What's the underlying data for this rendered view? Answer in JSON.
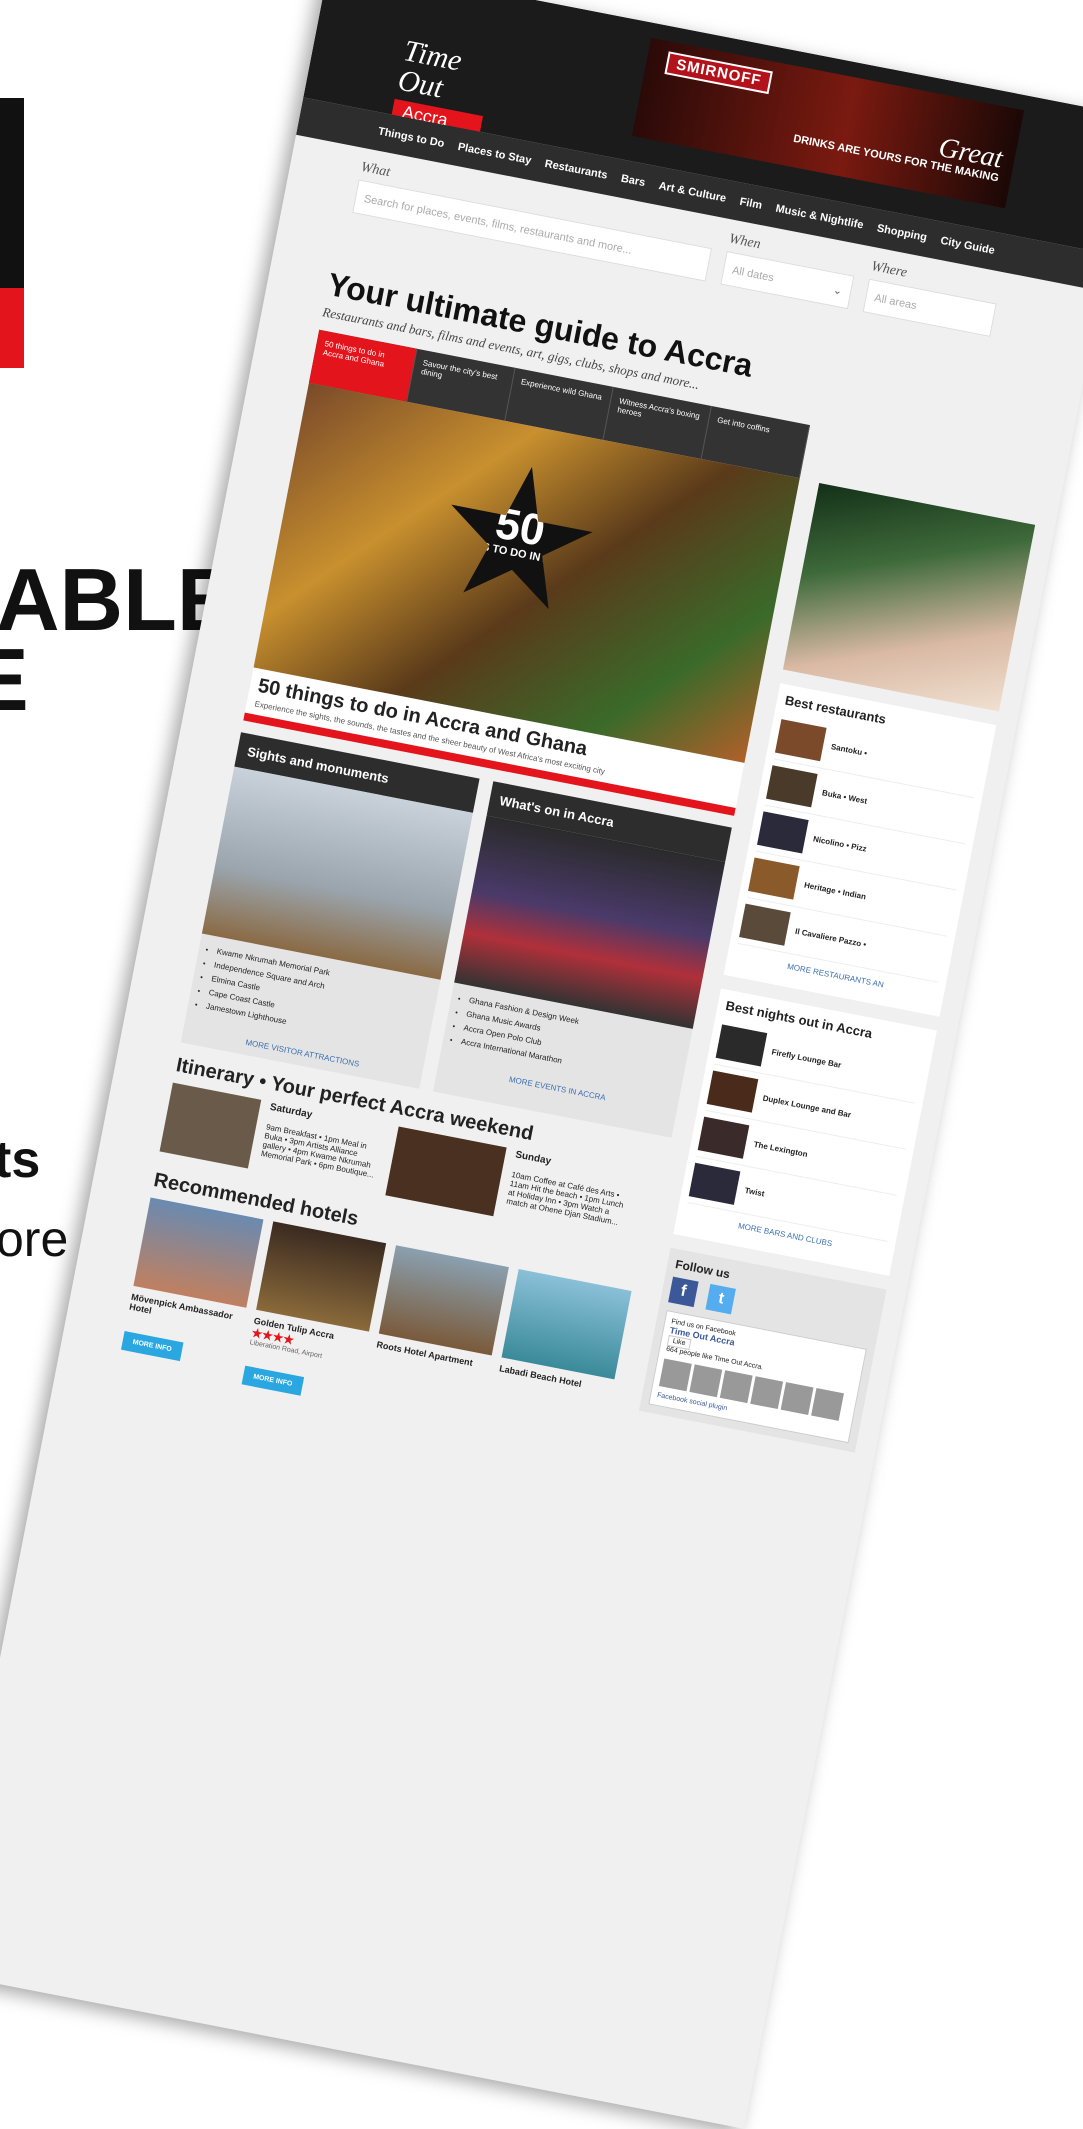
{
  "left": {
    "frag_able": "ABLE",
    "frag_e": "E",
    "frag_ts": "ts",
    "frag_ore": "ore"
  },
  "site": {
    "brand": "Time Out",
    "city": "Accra"
  },
  "ad": {
    "brand": "SMIRNOFF",
    "tagline_big": "Great",
    "tagline_small": "DRINKS ARE YOURS FOR THE MAKING"
  },
  "nav": [
    "Things to Do",
    "Places to Stay",
    "Restaurants",
    "Bars",
    "Art & Culture",
    "Film",
    "Music & Nightlife",
    "Shopping",
    "City Guide"
  ],
  "search": {
    "what_label": "What",
    "what_placeholder": "Search for places, events, films, restaurants and more...",
    "when_label": "When",
    "when_value": "All dates",
    "where_label": "Where",
    "where_value": "All areas"
  },
  "hero": {
    "title": "Your ultimate guide to Accra",
    "subtitle": "Restaurants and bars, films and events, art, gigs, clubs, shops and more...",
    "tabs": [
      "50 things to do in Accra and Ghana",
      "Savour the city's best dining",
      "Experience wild Ghana",
      "Witness Accra's boxing heroes",
      "Get into coffins"
    ],
    "badge_number": "50",
    "badge_text": "THINGS TO DO IN ACCRA",
    "feature_title": "50 things to do in Accra and Ghana",
    "feature_desc": "Experience the sights, the sounds, the tastes and the sheer beauty of West Africa's most exciting city"
  },
  "sights": {
    "heading": "Sights and monuments",
    "items": [
      "Kwame Nkrumah Memorial Park",
      "Independence Square and Arch",
      "Elmina Castle",
      "Cape Coast Castle",
      "Jamestown Lighthouse"
    ],
    "more": "MORE VISITOR ATTRACTIONS"
  },
  "whatson": {
    "heading": "What's on in Accra",
    "items": [
      "Ghana Fashion & Design Week",
      "Ghana Music Awards",
      "Accra Open Polo Club",
      "Accra International Marathon"
    ],
    "more": "MORE EVENTS IN ACCRA"
  },
  "itinerary": {
    "title": "Itinerary • Your perfect Accra weekend",
    "sat_day": "Saturday",
    "sat_text": "9am Breakfast • 1pm Meal in Buka • 3pm Artists Alliance gallery • 4pm Kwame Nkrumah Memorial Park • 6pm Boutique...",
    "sun_day": "Sunday",
    "sun_text": "10am Coffee at Café des Arts • 11am Hit the beach • 1pm Lunch at Holiday Inn • 3pm Watch a match at Ohene Djan Stadium..."
  },
  "hotels": {
    "title": "Recommended hotels",
    "list": [
      {
        "name": "Mövenpick Ambassador Hotel",
        "stars": "",
        "addr": ""
      },
      {
        "name": "Golden Tulip Accra",
        "stars": "★★★★",
        "addr": "Liberation Road, Airport"
      },
      {
        "name": "Roots Hotel Apartment",
        "stars": "",
        "addr": ""
      },
      {
        "name": "Labadi Beach Hotel",
        "stars": "",
        "addr": ""
      }
    ],
    "more_info": "MORE INFO"
  },
  "restaurants": {
    "title": "Best restaurants",
    "items": [
      "Santoku •",
      "Buka • West",
      "Nicolino • Pizz",
      "Heritage • Indian",
      "Il Cavaliere Pazzo •"
    ],
    "more": "MORE RESTAURANTS AN"
  },
  "nights": {
    "title": "Best nights out in Accra",
    "items": [
      "Firefly Lounge Bar",
      "Duplex Lounge and Bar",
      "The Lexington",
      "Twist"
    ],
    "more": "MORE BARS AND CLUBS"
  },
  "follow": {
    "title": "Follow us",
    "fb_find": "Find us on Facebook",
    "page_name": "Time Out Accra",
    "like": "Like",
    "people": "664 people like Time Out Accra.",
    "plugin": "Facebook social plugin"
  },
  "colors": {
    "accent": "#e3141b",
    "header": "#1b1b1b",
    "link": "#3a6fb0",
    "facebook": "#3b5998",
    "twitter": "#55acee"
  }
}
